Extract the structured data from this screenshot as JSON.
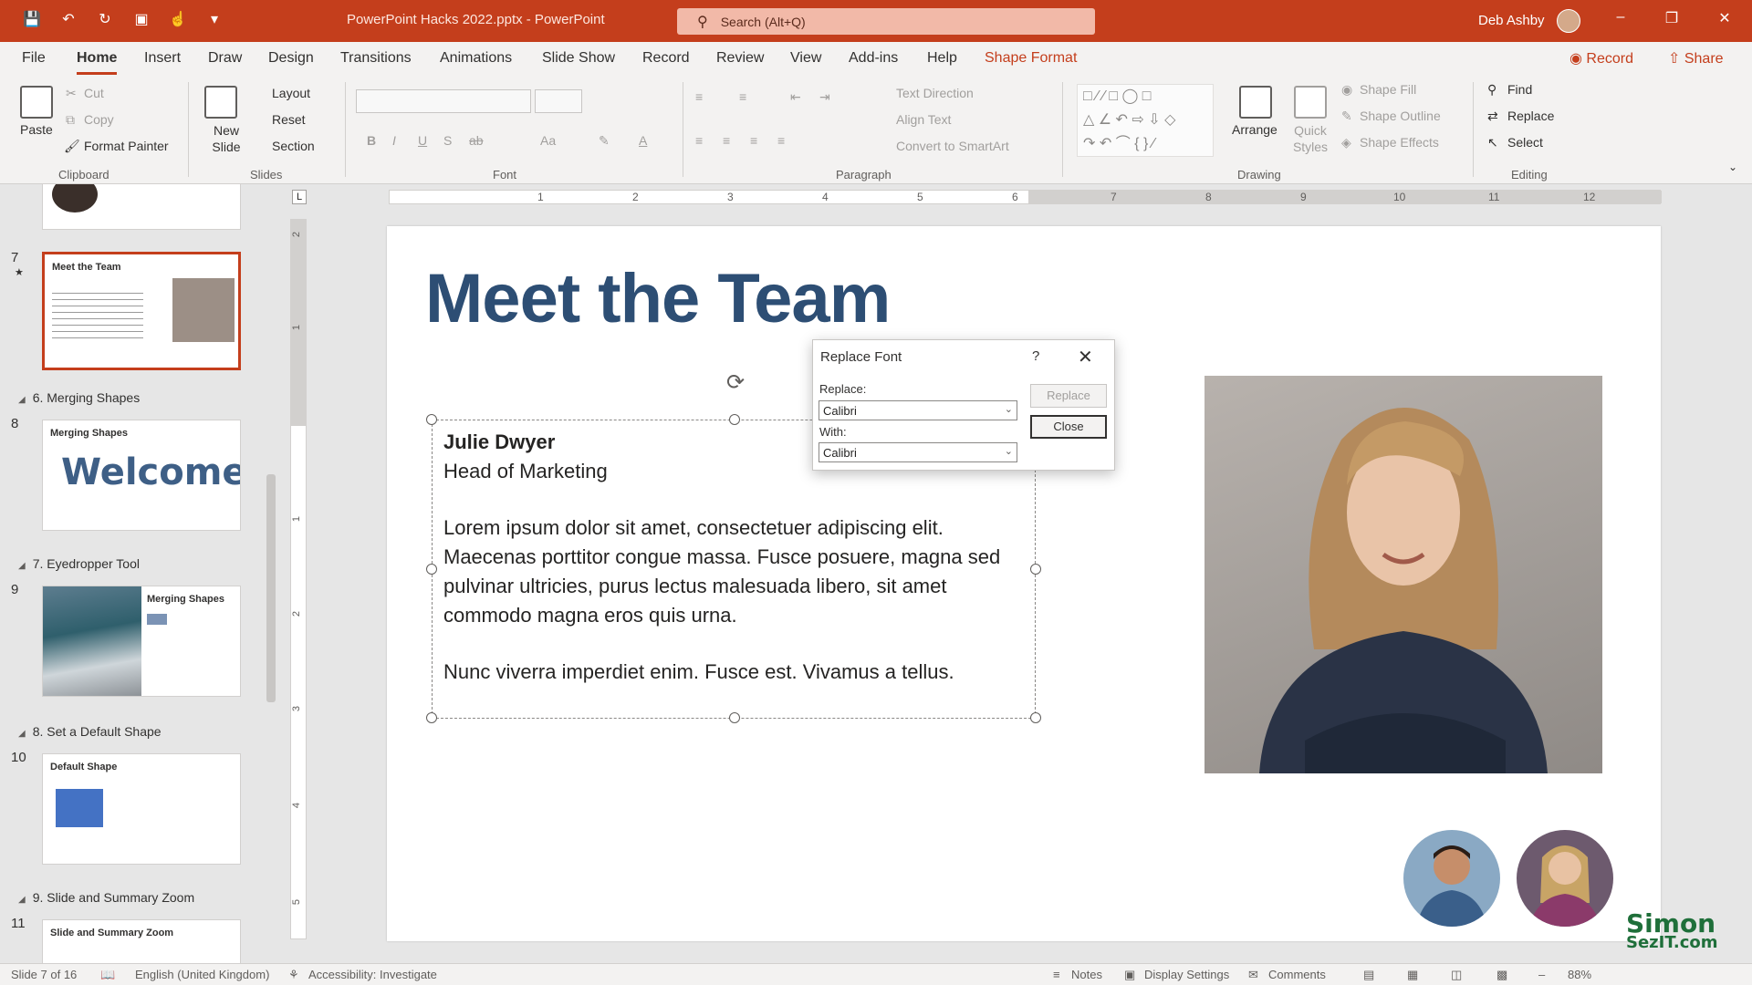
{
  "titlebar": {
    "document_title": "PowerPoint Hacks 2022.pptx  -  PowerPoint",
    "search_placeholder": "Search (Alt+Q)",
    "user_name": "Deb Ashby"
  },
  "menu": {
    "tabs": [
      "File",
      "Home",
      "Insert",
      "Draw",
      "Design",
      "Transitions",
      "Animations",
      "Slide Show",
      "Record",
      "Review",
      "View",
      "Add-ins",
      "Help",
      "Shape Format"
    ],
    "active": "Home",
    "record": "Record",
    "share": "Share"
  },
  "ribbon": {
    "clipboard": {
      "paste": "Paste",
      "cut": "Cut",
      "copy": "Copy",
      "format_painter": "Format Painter",
      "label": "Clipboard"
    },
    "slides": {
      "new_slide": "New Slide",
      "layout": "Layout",
      "reset": "Reset",
      "section": "Section",
      "label": "Slides"
    },
    "font": {
      "label": "Font"
    },
    "paragraph": {
      "text_direction": "Text Direction",
      "align_text": "Align Text",
      "convert_smartart": "Convert to SmartArt",
      "label": "Paragraph"
    },
    "drawing": {
      "arrange": "Arrange",
      "quick_styles": "Quick Styles",
      "shape_fill": "Shape Fill",
      "shape_outline": "Shape Outline",
      "shape_effects": "Shape Effects",
      "label": "Drawing"
    },
    "editing": {
      "find": "Find",
      "replace": "Replace",
      "select": "Select",
      "label": "Editing"
    }
  },
  "thumbnails": {
    "slide7": {
      "num": "7",
      "title": "Meet the Team"
    },
    "section6": "6. Merging Shapes",
    "slide8": {
      "num": "8",
      "title": "Merging Shapes",
      "word": "Welcome"
    },
    "section7": "7. Eyedropper Tool",
    "slide9": {
      "num": "9",
      "title": "Merging Shapes"
    },
    "section8": "8. Set a Default Shape",
    "slide10": {
      "num": "10",
      "title": "Default Shape"
    },
    "section9": "9. Slide and Summary Zoom",
    "slide11": {
      "num": "11",
      "title": "Slide and Summary Zoom"
    }
  },
  "ruler": {
    "h": [
      "1",
      "2",
      "3",
      "4",
      "5",
      "6",
      "7",
      "8",
      "9",
      "10",
      "11",
      "12"
    ],
    "v": [
      "2",
      "1",
      "1",
      "2",
      "3",
      "4",
      "5"
    ]
  },
  "slide": {
    "title": "Meet the Team",
    "name": "Julie Dwyer",
    "role": "Head of Marketing",
    "para1": "Lorem ipsum dolor sit amet, consectetuer adipiscing elit. Maecenas porttitor congue massa. Fusce posuere, magna sed pulvinar ultricies, purus lectus malesuada libero, sit amet commodo magna eros quis urna.",
    "para2": "Nunc viverra imperdiet enim. Fusce est. Vivamus a tellus."
  },
  "dialog": {
    "title": "Replace Font",
    "help": "?",
    "replace_label": "Replace:",
    "replace_value": "Calibri",
    "with_label": "With:",
    "with_value": "Calibri",
    "replace_button": "Replace",
    "close_button": "Close"
  },
  "logo": {
    "line1": "Simon",
    "line2": "SezIT.com"
  },
  "statusbar": {
    "slide": "Slide 7 of 16",
    "language": "English (United Kingdom)",
    "accessibility": "Accessibility: Investigate",
    "notes": "Notes",
    "display": "Display Settings",
    "comments": "Comments",
    "zoom": "88%"
  },
  "colors": {
    "accent": "#c43e1c",
    "title_blue": "#2d4e74"
  }
}
